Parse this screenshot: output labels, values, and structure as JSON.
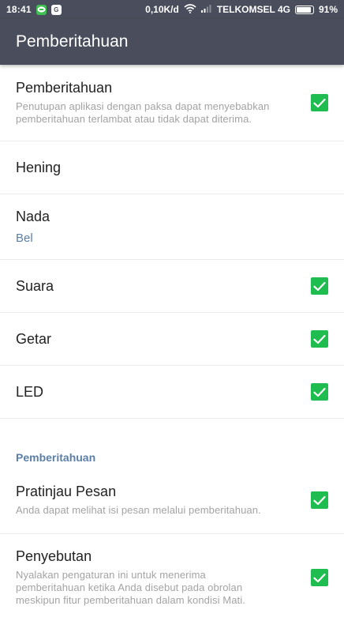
{
  "status_bar": {
    "time": "18:41",
    "net_speed": "0,10K/d",
    "carrier": "TELKOMSEL 4G",
    "battery": "91%",
    "battery_level": 0.91,
    "app_icons": [
      "line-icon",
      "g-icon"
    ]
  },
  "app_bar": {
    "title": "Pemberitahuan"
  },
  "settings": {
    "notifications": {
      "title": "Pemberitahuan",
      "desc_lines": [
        "Penutupan aplikasi dengan paksa dapat menyebabkan",
        "pemberitahuan terlambat atau tidak dapat diterima."
      ],
      "checked": true
    },
    "silent": {
      "title": "Hening"
    },
    "tone": {
      "title": "Nada",
      "value": "Bel"
    },
    "sound": {
      "title": "Suara",
      "checked": true
    },
    "vibrate": {
      "title": "Getar",
      "checked": true
    },
    "led": {
      "title": "LED",
      "checked": true
    }
  },
  "section": {
    "header": "Pemberitahuan",
    "preview": {
      "title": "Pratinjau Pesan",
      "desc_lines": [
        "Anda dapat melihat isi pesan melalui pemberitahuan."
      ],
      "checked": true
    },
    "mention": {
      "title": "Penyebutan",
      "desc_lines": [
        "Nyalakan pengaturan ini untuk menerima",
        "pemberitahuan ketika Anda disebut pada obrolan",
        "meskipun fitur pemberitahuan dalam kondisi Mati."
      ],
      "checked": true
    }
  },
  "colors": {
    "app_bar": "#4a4e5c",
    "checkbox": "#1fbd4f",
    "accent_text": "#5b7fa7"
  }
}
